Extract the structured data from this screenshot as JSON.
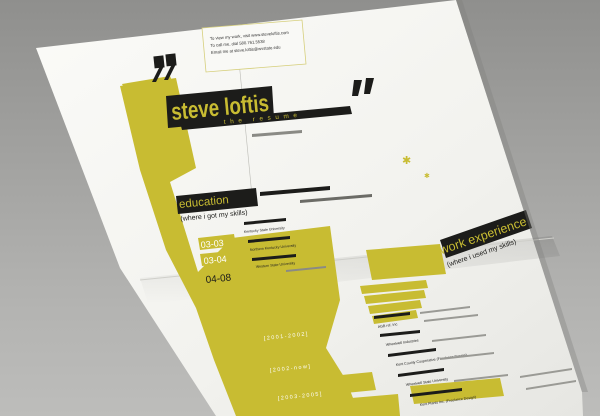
{
  "resume": {
    "name": "steve loftis",
    "subtitle": "the resume",
    "contact": {
      "line1": "To view my work, visit www.steveloftis.com",
      "line2": "To call me, dial 580.761.5538",
      "line3": "Email me at steve.loftis@wvstate.edu"
    },
    "sections": {
      "education_title": "education",
      "education_subtitle": "(where i got my skills)",
      "work_title": "work experience",
      "work_subtitle": "(where i used my skills)"
    },
    "education_dates": [
      "03-03",
      "03-04",
      "04-08"
    ],
    "education_entries": [
      "Kentucky State University",
      "Northern Kentucky University",
      "Western State University"
    ],
    "work_entries": [
      "AGB ref. Inc.",
      "Wheelwell Industries",
      "Kent County Cooperative (Freelance Design)",
      "Wheelwell State University",
      "Kent Plants Inc. (Freelance Design)"
    ],
    "work_dates": [
      "[ 2 0 0 1 - 2 0 0 2 ]",
      "[ 2 0 0 2 - n o w ]",
      "[ 2 0 0 3 - 2 0 0 5 ]"
    ],
    "colors": {
      "accent": "#c8bc32",
      "dark": "#1c1c1a",
      "paper": "#f5f5f2"
    }
  }
}
